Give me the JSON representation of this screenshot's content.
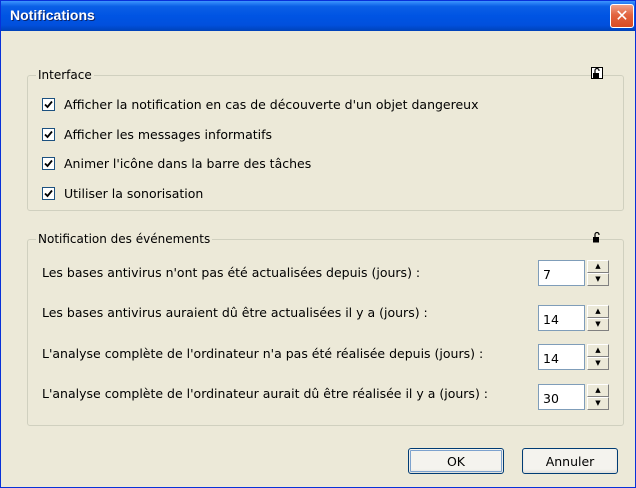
{
  "window": {
    "title": "Notifications",
    "close_glyph": "✕"
  },
  "interface_group": {
    "legend": "Interface",
    "lock_icon": "unlocked-padlock-icon",
    "options": [
      {
        "label": "Afficher la notification en cas de découverte d'un objet dangereux",
        "checked": true
      },
      {
        "label": "Afficher les messages informatifs",
        "checked": true
      },
      {
        "label": "Animer l'icône dans la barre des tâches",
        "checked": true
      },
      {
        "label": "Utiliser la sonorisation",
        "checked": true
      }
    ]
  },
  "events_group": {
    "legend": "Notification des événements",
    "lock_icon": "unlocked-padlock-icon",
    "rows": [
      {
        "label": "Les bases antivirus n'ont pas été actualisées depuis (jours) :",
        "value": "7"
      },
      {
        "label": "Les bases antivirus auraient dû être actualisées il y a (jours) :",
        "value": "14"
      },
      {
        "label": "L'analyse complète de l'ordinateur n'a pas été réalisée depuis (jours) :",
        "value": "14"
      },
      {
        "label": "L'analyse complète de l'ordinateur aurait dû être réalisée il y a (jours) :",
        "value": "30"
      }
    ]
  },
  "buttons": {
    "ok": "OK",
    "cancel": "Annuler"
  },
  "colors": {
    "titlebar": "#0054e3",
    "dialog_bg": "#ece9d8",
    "close_button": "#d84a21"
  }
}
